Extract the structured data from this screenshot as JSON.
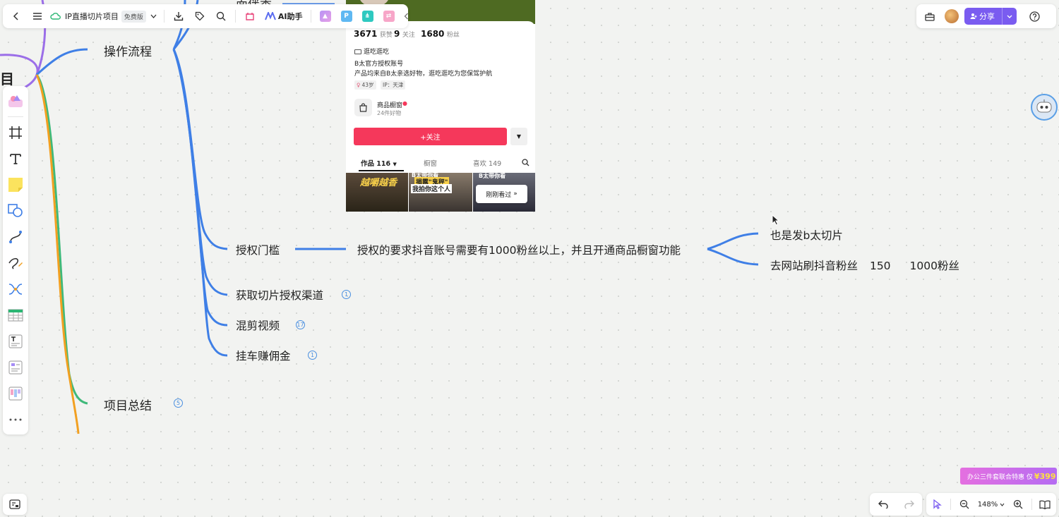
{
  "toolbar": {
    "project_title": "IP直播切片项目",
    "plan_badge": "免费版",
    "ai_label": "AI助手",
    "app_p_label": "P"
  },
  "topright": {
    "share_label": "分享"
  },
  "mindmap": {
    "root_fragment": "目",
    "top_fragment": "面伴香",
    "nodes": {
      "process": "操作流程",
      "auth_threshold": "授权门槛",
      "auth_requirement": "授权的要求抖音账号需要有1000粉丝以上，并且开通商品橱窗功能",
      "also_clips": "也是发b太切片",
      "buy_fans_prefix": "去网站刷抖音粉丝",
      "buy_fans_price": "150",
      "buy_fans_amount": "1000粉丝",
      "get_channel": "获取切片授权渠道",
      "mix_edit": "混剪视频",
      "commission": "挂车赚佣金",
      "summary": "项目总结"
    },
    "counts": {
      "get_channel": "1",
      "mix_edit": "17",
      "commission": "1",
      "summary": "5"
    },
    "colors": {
      "purple": "#9b6ee8",
      "blue": "#3f7fe6",
      "green": "#3fb97a",
      "orange": "#f2a021"
    }
  },
  "phone": {
    "likes_num": "3671",
    "likes_label": "获赞",
    "follow_num": "9",
    "follow_label": "关注",
    "fans_num": "1680",
    "fans_label": "粉丝",
    "account_tag": "逛吃逛吃",
    "bio_line1": "B太官方授权账号",
    "bio_line2": "产品均来自B太亲选好物，逛吃逛吃为您保驾护航",
    "chip_age": "43岁",
    "chip_ip": "IP：天津",
    "shop_title": "商品橱窗",
    "shop_sub": "24件好物",
    "follow_button": "+关注",
    "tab_works": "作品 116",
    "tab_window": "橱窗",
    "tab_likes": "喜欢 149",
    "thumb1_text": "越嚼越香",
    "thumb2_top": "B太带你看",
    "thumb2_mid": "揭露\"鬼秤\"",
    "thumb2_bot": "我拍你这个人",
    "thumb3_text": "B太带你看",
    "recent_button": "刚刚看过"
  },
  "bottom": {
    "zoom_level": "148%"
  },
  "promo": {
    "text": "办公三件套联合特惠 仅",
    "price": "¥399"
  }
}
